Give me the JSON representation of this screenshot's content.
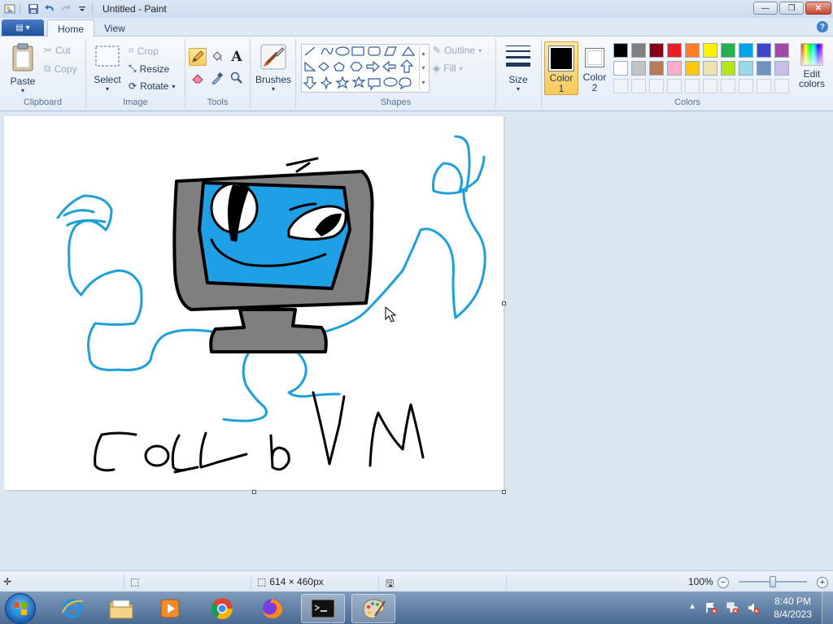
{
  "window": {
    "title": "Untitled - Paint",
    "buttons": {
      "minimize": "—",
      "maximize": "❐",
      "close": "✕"
    }
  },
  "ribbon_tabs": {
    "file_label": "▤ ▾",
    "home": "Home",
    "view": "View",
    "help": "?"
  },
  "clipboard": {
    "paste": "Paste",
    "cut": "Cut",
    "copy": "Copy",
    "label": "Clipboard"
  },
  "image": {
    "select": "Select",
    "crop": "Crop",
    "resize": "Resize",
    "rotate": "Rotate",
    "label": "Image"
  },
  "tools": {
    "label": "Tools",
    "text_tool": "A"
  },
  "brushes": {
    "label": "Brushes"
  },
  "shapes": {
    "outline": "Outline",
    "fill": "Fill",
    "label": "Shapes"
  },
  "size": {
    "label": "Size"
  },
  "colors": {
    "color1_label_a": "Color",
    "color1_label_b": "1",
    "color2_label_a": "Color",
    "color2_label_b": "2",
    "edit_a": "Edit",
    "edit_b": "colors",
    "label": "Colors",
    "color1": "#000000",
    "color2": "#ffffff",
    "palette_row1": [
      "#000000",
      "#7f7f7f",
      "#880015",
      "#ed1c24",
      "#ff7f27",
      "#fff200",
      "#22b14c",
      "#00a2e8",
      "#3f48cc",
      "#a349a4"
    ],
    "palette_row2": [
      "#ffffff",
      "#c3c3c3",
      "#b97a57",
      "#ffaec9",
      "#ffc90e",
      "#efe4b0",
      "#b5e61d",
      "#99d9ea",
      "#7092be",
      "#c8bfe7"
    ]
  },
  "canvas": {
    "drawing_brush_color": "#1e9fd8",
    "screen_color": "#1e9fe6",
    "monitor_color": "#7f7f7f"
  },
  "statusbar": {
    "dimensions": "614 × 460px",
    "zoom": "100%",
    "zoom_level": 1.0
  },
  "taskbar": {
    "time": "8:40 PM",
    "date": "8/4/2023"
  }
}
